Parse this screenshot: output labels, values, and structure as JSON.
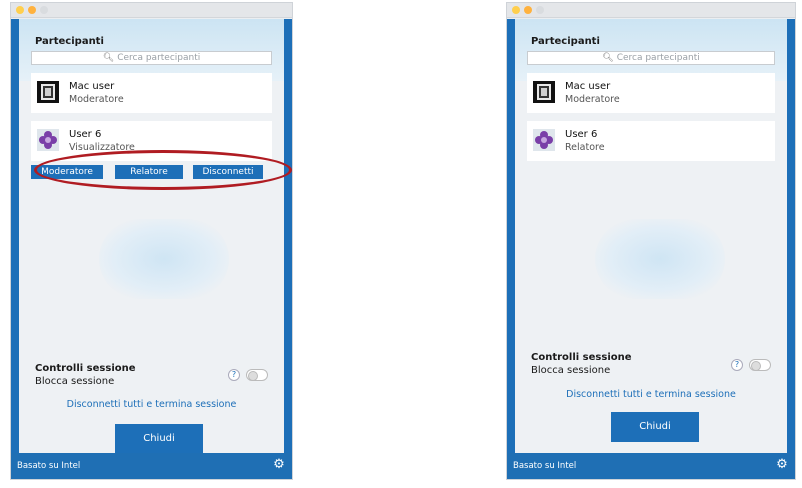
{
  "left_window": {
    "title": "Partecipanti",
    "search_placeholder": "Cerca partecipanti",
    "participants": [
      {
        "name": "Mac user",
        "role": "Moderatore",
        "avatar_icon": "film-icon"
      },
      {
        "name": "User 6",
        "role": "Visualizzatore",
        "avatar_icon": "flower-icon"
      }
    ],
    "actions": [
      "Moderatore",
      "Relatore",
      "Disconnetti"
    ],
    "session": {
      "title": "Controlli sessione",
      "lock_label": "Blocca sessione",
      "help": "?",
      "end_link": "Disconnetti tutti e termina sessione",
      "close": "Chiudi"
    },
    "footer": {
      "brand": "Basato su Intel",
      "gear_icon": "gear-icon"
    }
  },
  "right_window": {
    "title": "Partecipanti",
    "search_placeholder": "Cerca partecipanti",
    "participants": [
      {
        "name": "Mac user",
        "role": "Moderatore",
        "avatar_icon": "film-icon"
      },
      {
        "name": "User 6",
        "role": "Relatore",
        "avatar_icon": "flower-icon"
      }
    ],
    "session": {
      "title": "Controlli sessione",
      "lock_label": "Blocca sessione",
      "help": "?",
      "end_link": "Disconnetti tutti e termina sessione",
      "close": "Chiudi"
    },
    "footer": {
      "brand": "Basato su Intel",
      "gear_icon": "gear-icon"
    }
  },
  "colors": {
    "accent": "#1d6fb8",
    "highlight_ring": "#b01c22"
  }
}
